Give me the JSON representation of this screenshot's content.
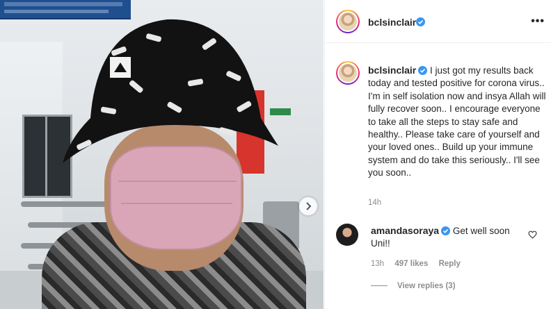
{
  "post": {
    "author": "bclsinclair",
    "more_icon": "more-icon",
    "next_icon": "chevron-right-icon"
  },
  "caption": {
    "author": "bclsinclair",
    "text": "I just got my results back today and tested positive for corona virus.. I'm in self isolation now and insya Allah will fully recover soon.. I encourage everyone to take all the steps to stay safe and healthy.. Please take care of yourself and your loved ones.. Build up your immune system and do take this seriously.. I'll see you soon..",
    "time": "14h"
  },
  "comment": {
    "author": "amandasoraya",
    "text": "Get well soon Uni!!",
    "time": "13h",
    "likes": "497 likes",
    "reply": "Reply",
    "view_replies": "View replies (3)"
  },
  "colors": {
    "verified": "#3897f0",
    "muted_text": "#8e8e8e",
    "primary_text": "#262626"
  }
}
